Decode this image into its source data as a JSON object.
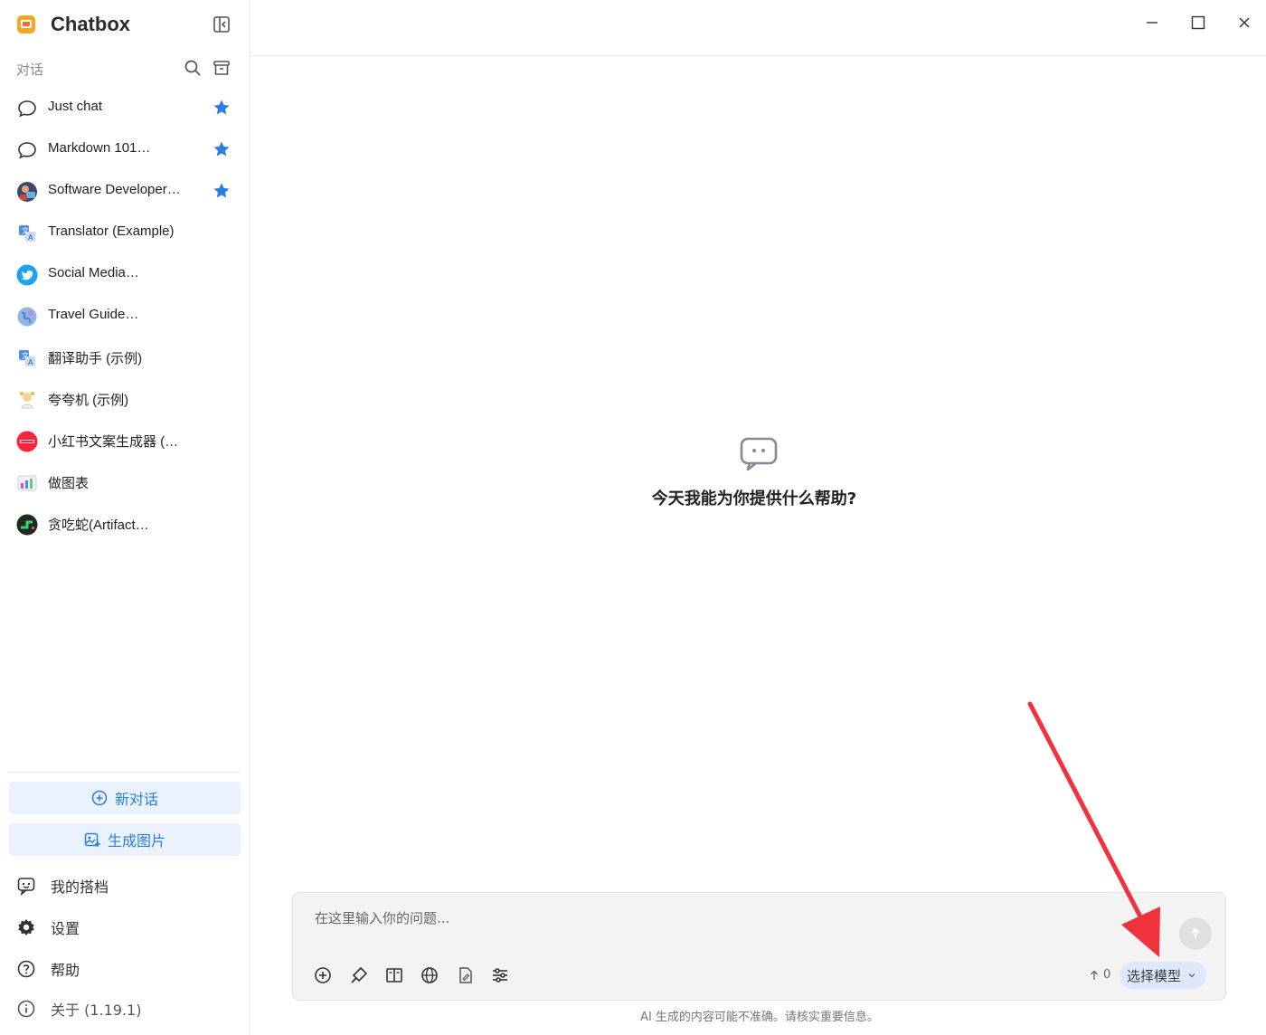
{
  "app": {
    "title": "Chatbox"
  },
  "sidebar": {
    "section_label": "对话",
    "conversations": [
      {
        "label": "Just chat",
        "icon": "chat-bubble-icon",
        "starred": true
      },
      {
        "label": "Markdown 101…",
        "icon": "chat-bubble-icon",
        "starred": true
      },
      {
        "label": "Software Developer…",
        "icon": "developer-avatar-icon",
        "starred": true
      },
      {
        "label": "Translator (Example)",
        "icon": "translator-avatar-icon",
        "starred": false
      },
      {
        "label": "Social Media…",
        "icon": "twitter-bird-icon",
        "starred": false
      },
      {
        "label": "Travel Guide…",
        "icon": "globe-avatar-icon",
        "starred": false
      },
      {
        "label": "翻译助手 (示例)",
        "icon": "translator-avatar-icon",
        "starred": false
      },
      {
        "label": "夸夸机 (示例)",
        "icon": "cheer-avatar-icon",
        "starred": false
      },
      {
        "label": "小红书文案生成器 (…",
        "icon": "xiaohongshu-logo-icon",
        "starred": false
      },
      {
        "label": "做图表",
        "icon": "chart-avatar-icon",
        "starred": false
      },
      {
        "label": "贪吃蛇(Artifact…",
        "icon": "snake-game-avatar-icon",
        "starred": false
      }
    ],
    "new_chat_label": "新对话",
    "generate_image_label": "生成图片",
    "my_copilots_label": "我的搭档",
    "settings_label": "设置",
    "help_label": "帮助",
    "about_label": "关于 (1.19.1)"
  },
  "main": {
    "empty_title": "今天我能为你提供什么帮助?",
    "input_placeholder": "在这里输入你的问题...",
    "token_count": "0",
    "model_select_label": "选择模型",
    "disclaimer": "AI 生成的内容可能不准确。请核实重要信息。"
  },
  "colors": {
    "accent": "#2a7de1",
    "star": "#2a7de1",
    "arrow": "#f0323c",
    "action_bg": "#e9f2fd"
  }
}
